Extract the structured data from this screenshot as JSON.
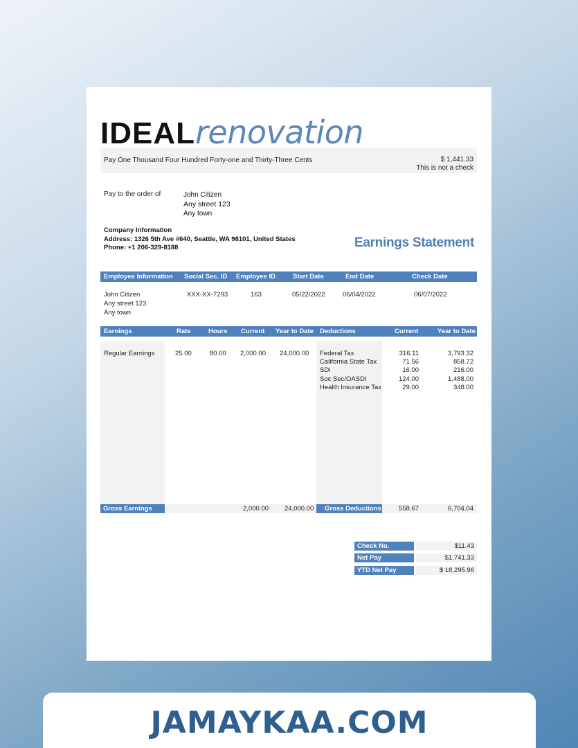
{
  "logo": {
    "bold": "IDEAL",
    "light": "renovation"
  },
  "pay_line": {
    "words": "Pay One Thousand Four Hundred Forty-one and Thirty-Three Cents",
    "amount": "$ 1,441.33",
    "note": "This is not a check"
  },
  "payee": {
    "label": "Pay to the order of",
    "name": "John Citizen",
    "street": "Any street 123",
    "town": "Any town"
  },
  "company": {
    "heading": "Company Information",
    "address": "Address: 1326 5th Ave #640, Seattle, WA 98101, United States",
    "phone": "Phone: +1 206-329-8188"
  },
  "statement_title": "Earnings Statement",
  "employee_header": [
    "Employee Information",
    "Social Sec. ID",
    "Employee ID",
    "Start Date",
    "End Date",
    "Check Date"
  ],
  "employee": {
    "name": "John Citizen",
    "street": "Any street 123",
    "town": "Any town",
    "ssn": "XXX-XX-7293",
    "employee_id": "163",
    "start_date": "05/22/2022",
    "end_date": "06/04/2022",
    "check_date": "06/07/2022"
  },
  "earnings_header": [
    "Earnings",
    "Rate",
    "Hours",
    "Current",
    "Year to Date",
    "Deductions",
    "Current",
    "Year to Date"
  ],
  "earnings": {
    "label": "Regular Earnings",
    "rate": "25.00",
    "hours": "80.00",
    "current": "2,000.00",
    "ytd": "24,000.00"
  },
  "deductions": [
    {
      "label": "Federal Tax",
      "current": "316.11",
      "ytd": "3,793 32"
    },
    {
      "label": "California State Tax",
      "current": "71.56",
      "ytd": "858.72"
    },
    {
      "label": "SDI",
      "current": "16.00",
      "ytd": "216.00"
    },
    {
      "label": "Soc Sec/OASDI",
      "current": "124.00",
      "ytd": "1,488.00"
    },
    {
      "label": "Health Insurance Tax",
      "current": "29.00",
      "ytd": "348.00"
    }
  ],
  "totals": {
    "gross_earnings_label": "Gross Earnings",
    "gross_current": "2,000.00",
    "gross_ytd": "24,000.00",
    "gross_deductions_label": "Gross Deductions",
    "deductions_current": "558.67",
    "deductions_ytd": "6,704.04"
  },
  "summary": [
    {
      "label": "Check No.",
      "value": "$11.43"
    },
    {
      "label": "Net Pay",
      "value": "$1.741.33"
    },
    {
      "label": "YTD Net Pay",
      "value": "$ 18,295.96"
    }
  ],
  "footer": "JAMAYKAA.COM",
  "colors": {
    "header_blue": "#4f81bd",
    "logo_blue": "#5b86b9",
    "title_blue": "#4f7fb4",
    "footer_blue": "#2e5f8e",
    "grey": "#f2f2f2"
  }
}
